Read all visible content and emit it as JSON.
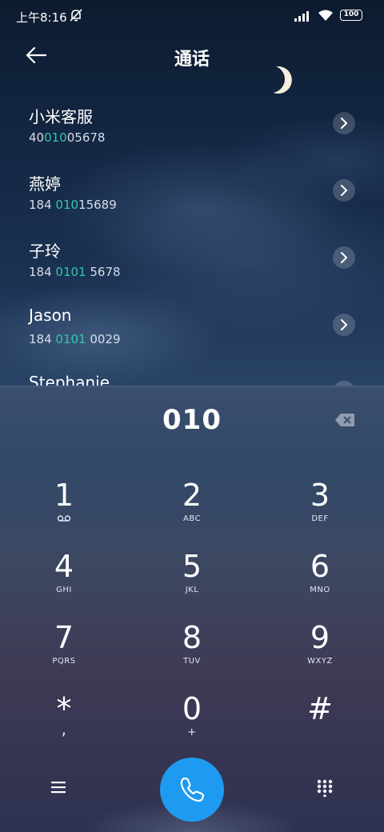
{
  "status_bar": {
    "time": "上午8:16",
    "battery": "100"
  },
  "header": {
    "title": "通话"
  },
  "contacts": [
    {
      "name": "小米客服",
      "num_pre": "40",
      "num_hl": "010",
      "num_post": "05678"
    },
    {
      "name": "燕婷",
      "num_pre": "184 ",
      "num_hl": "010",
      "num_post": "15689"
    },
    {
      "name": "子玲",
      "num_pre": "184 ",
      "num_hl": "0101",
      "num_post": " 5678"
    },
    {
      "name": "Jason",
      "num_pre": "184 ",
      "num_hl": "0101",
      "num_post": " 0029"
    },
    {
      "name": "Stephanie",
      "num_pre": "",
      "num_hl": "",
      "num_post": ""
    }
  ],
  "dialer": {
    "number": "010",
    "keys": [
      {
        "digit": "1",
        "letters": ""
      },
      {
        "digit": "2",
        "letters": "ABC"
      },
      {
        "digit": "3",
        "letters": "DEF"
      },
      {
        "digit": "4",
        "letters": "GHI"
      },
      {
        "digit": "5",
        "letters": "JKL"
      },
      {
        "digit": "6",
        "letters": "MNO"
      },
      {
        "digit": "7",
        "letters": "PQRS"
      },
      {
        "digit": "8",
        "letters": "TUV"
      },
      {
        "digit": "9",
        "letters": "WXYZ"
      },
      {
        "digit": "*",
        "letters": ","
      },
      {
        "digit": "0",
        "letters": "+"
      },
      {
        "digit": "#",
        "letters": ""
      }
    ]
  },
  "colors": {
    "highlight": "#34c7a6",
    "call_button": "#1e9bf0"
  },
  "icons": {
    "back": "arrow-left-icon",
    "mute": "mute-icon",
    "signal": "signal-icon",
    "wifi": "wifi-icon",
    "battery": "battery-icon",
    "contact_arrow": "chevron-right-icon",
    "backspace": "backspace-icon",
    "voicemail": "voicemail-icon",
    "menu": "menu-icon",
    "call": "phone-icon",
    "keypad": "keypad-icon"
  }
}
